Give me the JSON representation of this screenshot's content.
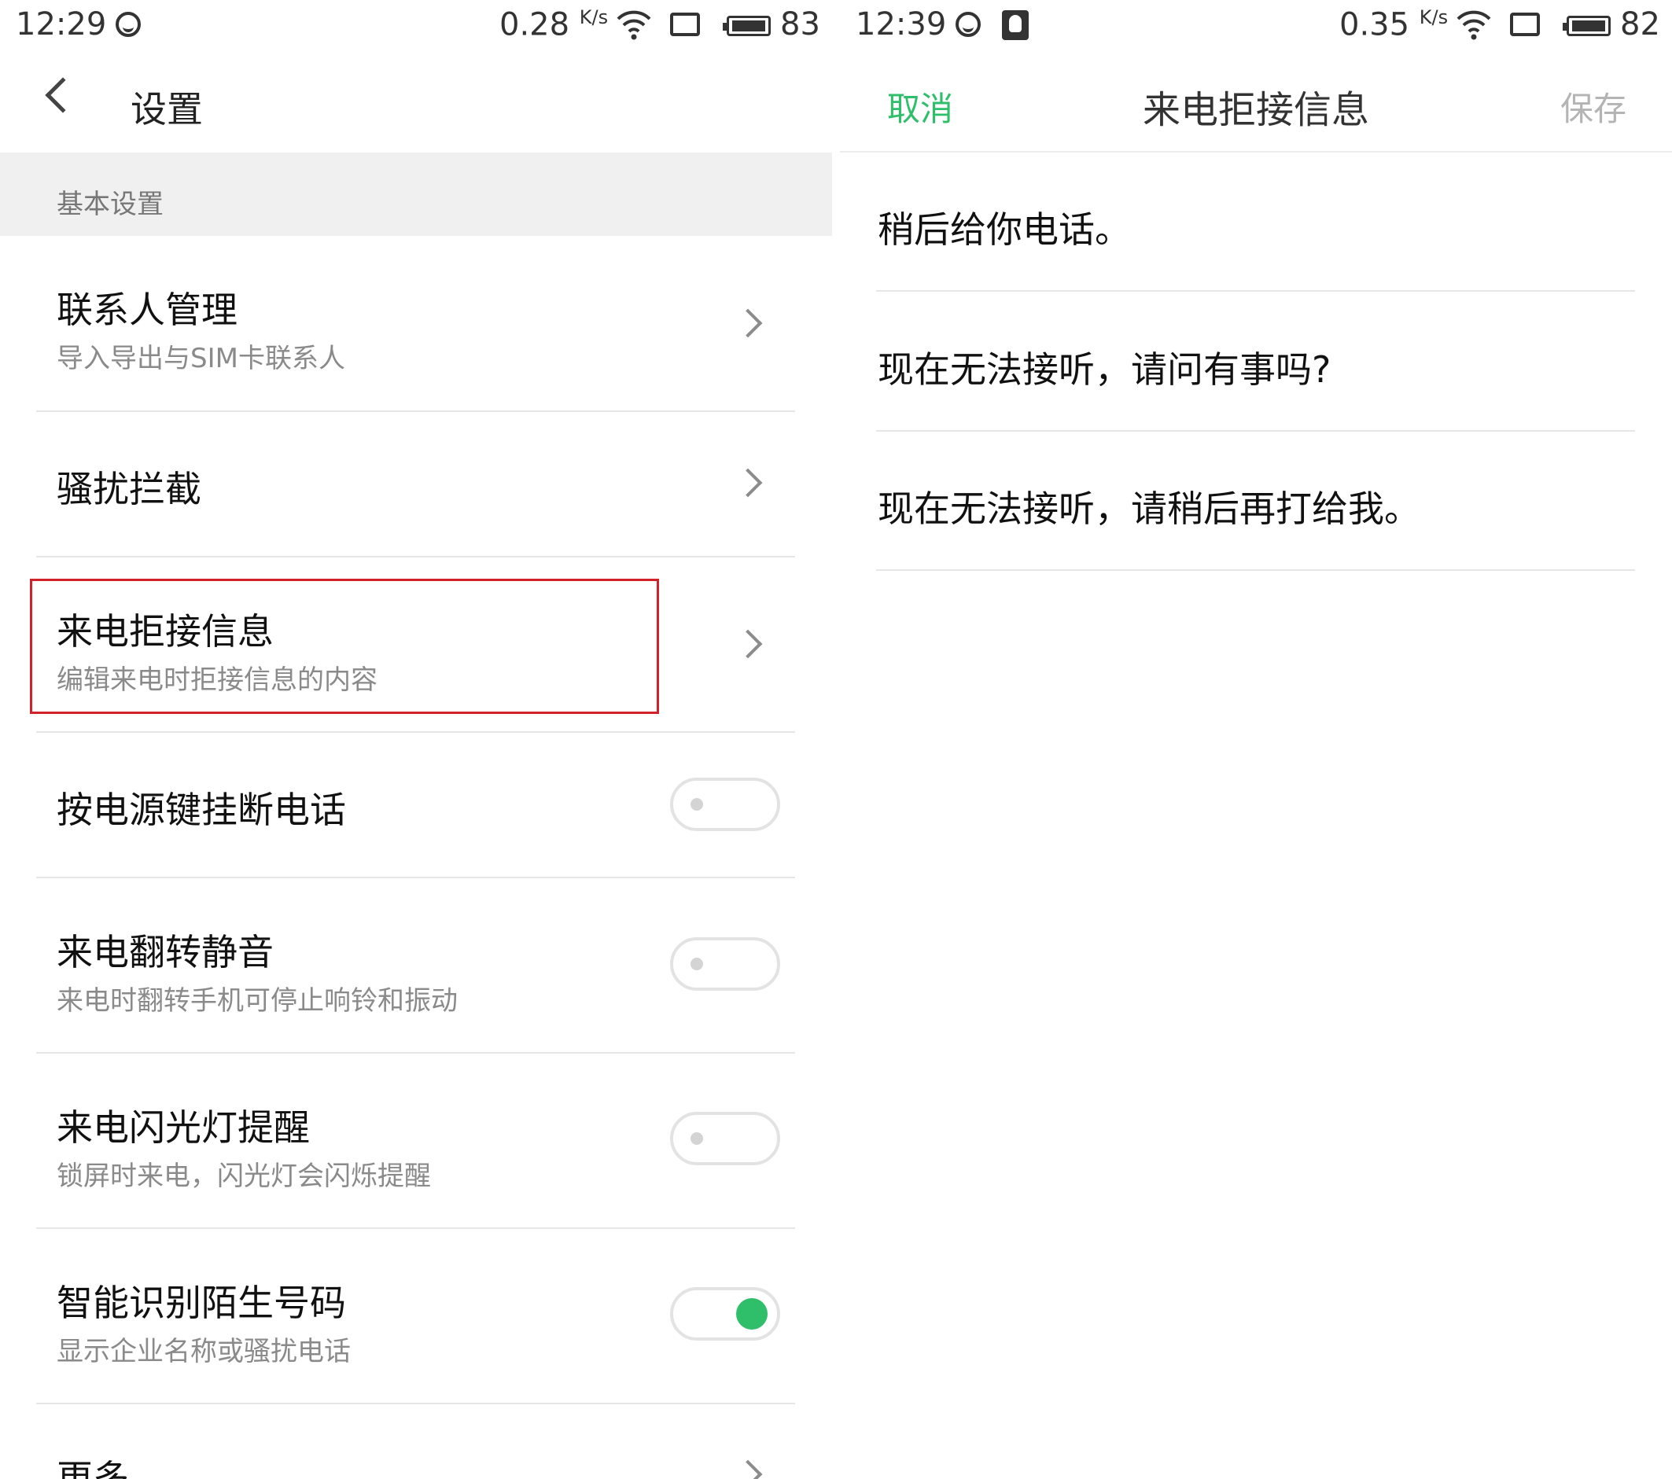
{
  "left": {
    "status": {
      "time": "12:29",
      "speed": "0.28",
      "speed_unit": "K/s",
      "battery": "83"
    },
    "header": {
      "title": "设置",
      "back_icon": "chevron-left-icon"
    },
    "section_label": "基本设置",
    "rows": [
      {
        "title": "联系人管理",
        "subtitle": "导入导出与SIM卡联系人",
        "control": "chevron"
      },
      {
        "title": "骚扰拦截",
        "control": "chevron"
      },
      {
        "title": "来电拒接信息",
        "subtitle": "编辑来电时拒接信息的内容",
        "control": "chevron",
        "highlighted": true
      },
      {
        "title": "按电源键挂断电话",
        "control": "toggle",
        "on": false
      },
      {
        "title": "来电翻转静音",
        "subtitle": "来电时翻转手机可停止响铃和振动",
        "control": "toggle",
        "on": false
      },
      {
        "title": "来电闪光灯提醒",
        "subtitle": "锁屏时来电，闪光灯会闪烁提醒",
        "control": "toggle",
        "on": false
      },
      {
        "title": "智能识别陌生号码",
        "subtitle": "显示企业名称或骚扰电话",
        "control": "toggle",
        "on": true
      },
      {
        "title": "更多",
        "control": "chevron"
      }
    ],
    "highlight_color": "#d1212a"
  },
  "right": {
    "status": {
      "time": "12:39",
      "speed": "0.35",
      "speed_unit": "K/s",
      "battery": "82"
    },
    "header": {
      "cancel": "取消",
      "title": "来电拒接信息",
      "save": "保存"
    },
    "messages": [
      "稍后给你电话。",
      "现在无法接听，请问有事吗?",
      "现在无法接听，请稍后再打给我。"
    ],
    "accent_color": "#2fbf6b"
  }
}
